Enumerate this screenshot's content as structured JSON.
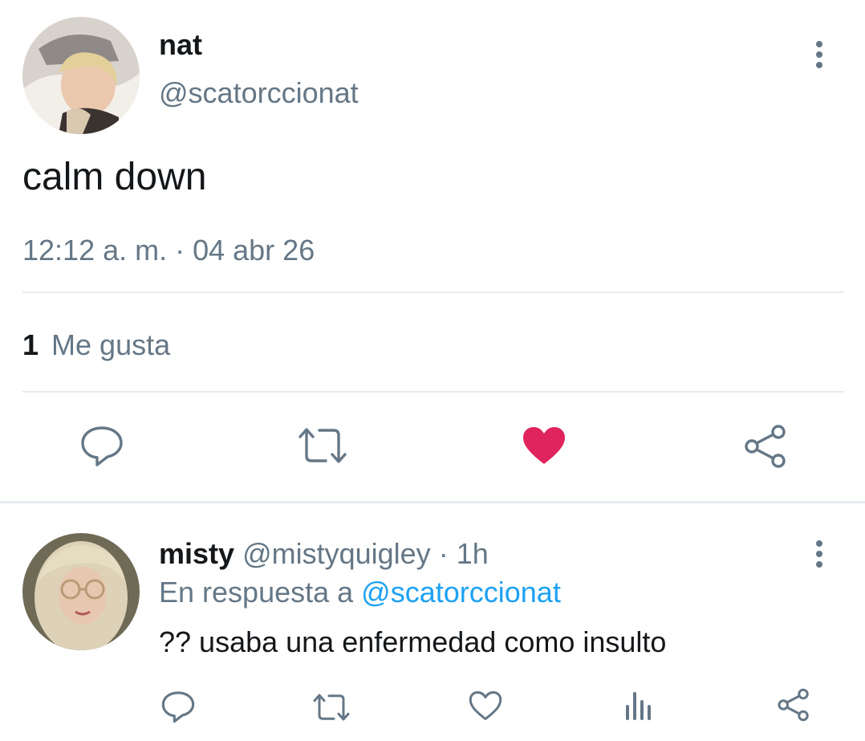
{
  "tweet": {
    "author": {
      "name": "nat",
      "handle": "@scatorccionat"
    },
    "text": "calm down",
    "timestamp": "12:12 a. m. · 04 abr 26",
    "likes": {
      "count": "1",
      "label": "Me gusta"
    },
    "liked": true,
    "actions": [
      "reply-icon",
      "retweet-icon",
      "heart-filled-icon",
      "share-icon"
    ]
  },
  "reply": {
    "author": {
      "name": "misty",
      "handle": "@mistyquigley",
      "time": "· 1h"
    },
    "in_reply_prefix": "En respuesta a",
    "in_reply_handle": "@scatorccionat",
    "text": "?? usaba una enfermedad como insulto",
    "actions": [
      "reply-icon",
      "retweet-icon",
      "heart-outline-icon",
      "analytics-icon",
      "share-icon"
    ]
  },
  "colors": {
    "like": "#e0245e",
    "link": "#1da1f2",
    "muted": "#657786",
    "divider": "#e6ecf0"
  }
}
